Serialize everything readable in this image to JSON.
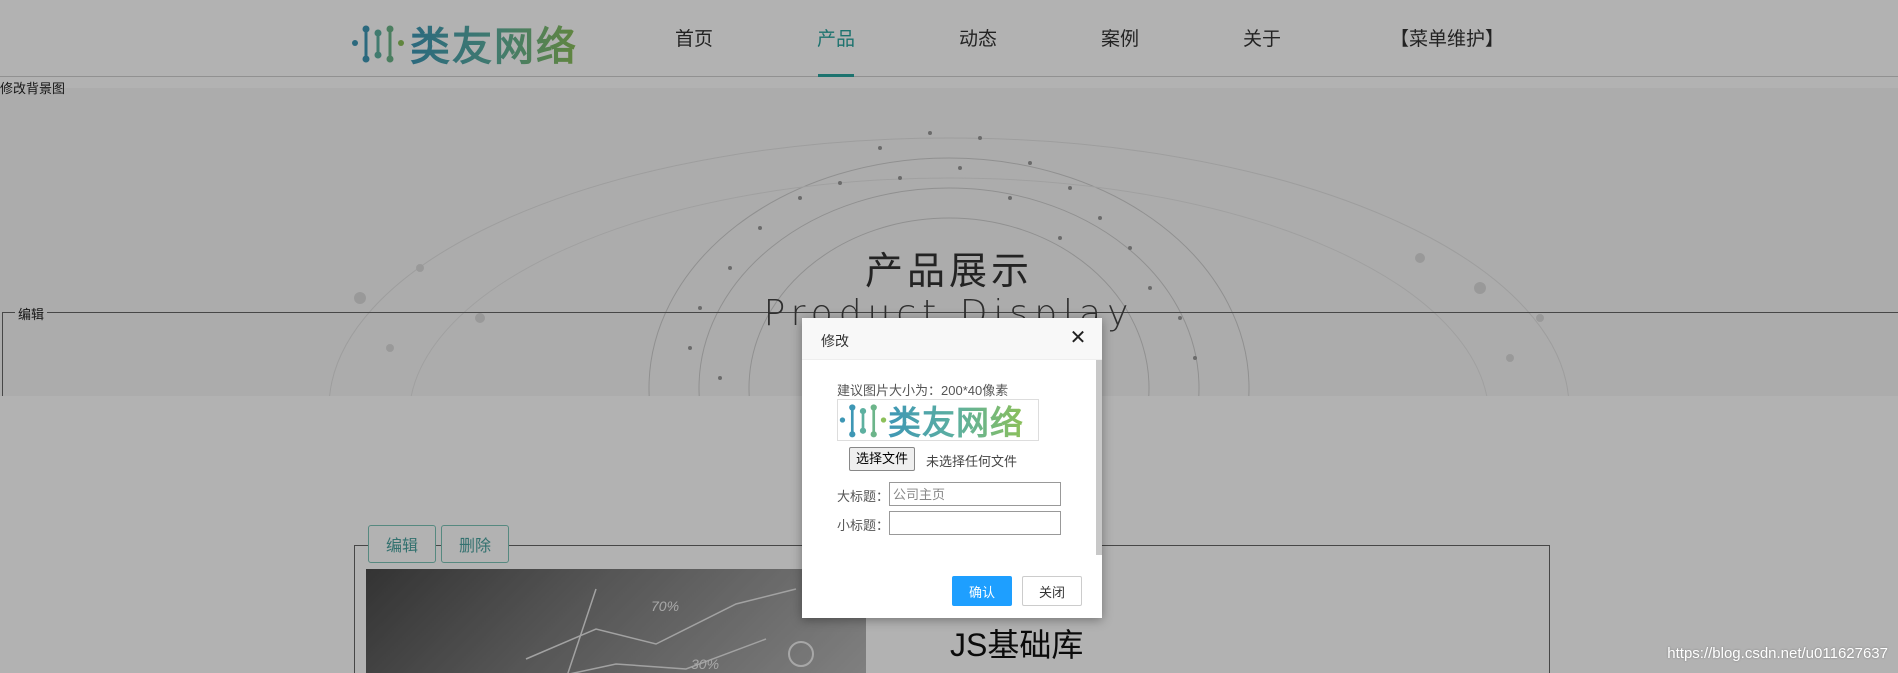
{
  "header": {
    "logo_text": "类友网络",
    "nav": [
      {
        "label": "首页",
        "active": false
      },
      {
        "label": "产品",
        "active": true
      },
      {
        "label": "动态",
        "active": false
      },
      {
        "label": "案例",
        "active": false
      },
      {
        "label": "关于",
        "active": false
      },
      {
        "label": "【菜单维护】",
        "active": false
      }
    ]
  },
  "banner": {
    "edit_bg_label": "修改背景图",
    "legend": "编辑",
    "title": "产品展示",
    "subtitle": "Product Display"
  },
  "content": {
    "edit_label": "编辑",
    "delete_label": "删除",
    "product_title": "JS基础库",
    "image_labels": [
      "70%",
      "30%"
    ]
  },
  "modal": {
    "title": "修改",
    "hint": "建议图片大小为：200*40像素",
    "logo_text": "类友网络",
    "file_button": "选择文件",
    "file_status": "未选择任何文件",
    "main_title_label": "大标题：",
    "main_title_placeholder": "公司主页",
    "sub_title_label": "小标题：",
    "sub_title_value": "",
    "confirm_label": "确认",
    "close_label": "关闭"
  },
  "watermark": "https://blog.csdn.net/u011627637",
  "colors": {
    "accent": "#2aa5a0",
    "primary_button": "#1e9fff",
    "overlay": "rgba(0,0,0,0.3)"
  }
}
